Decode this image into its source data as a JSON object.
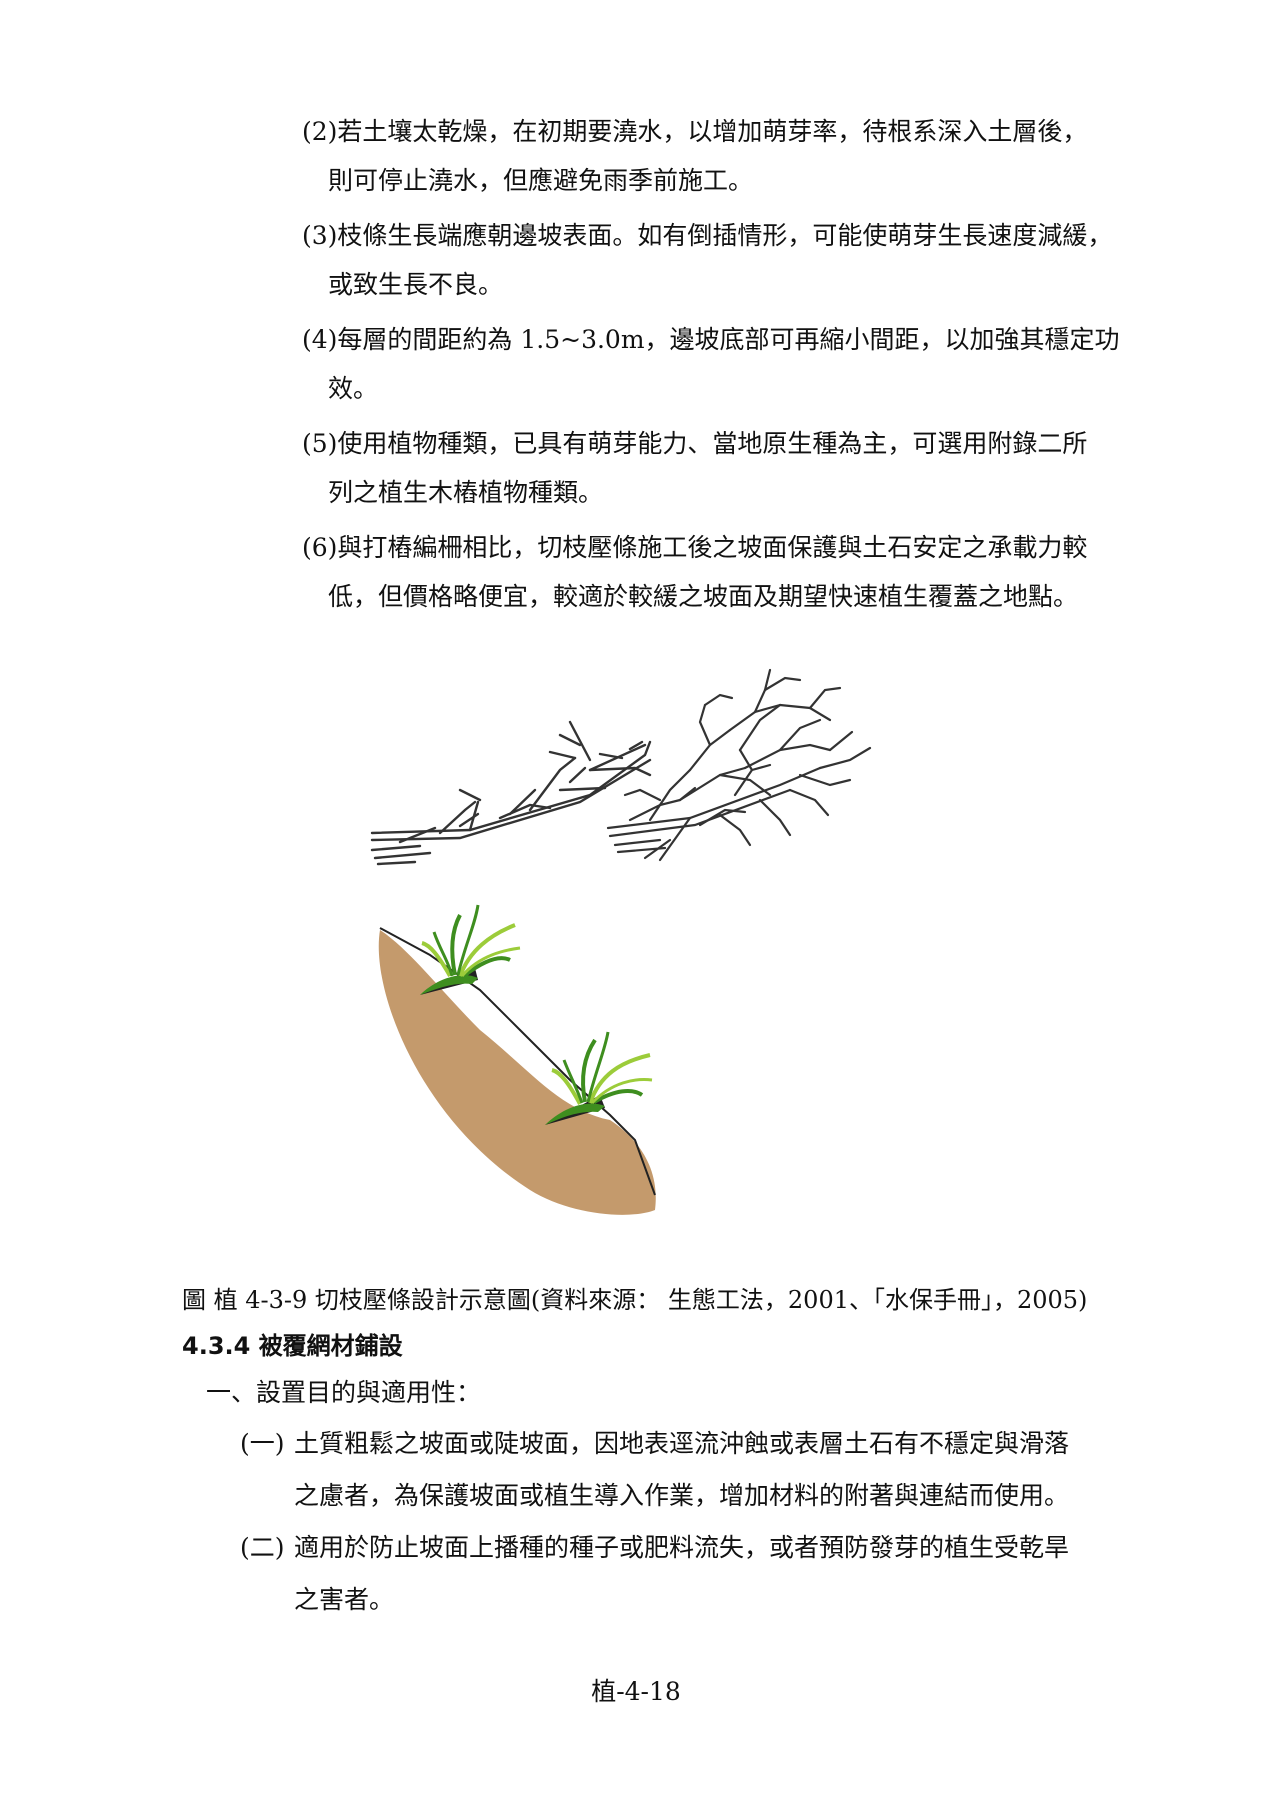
{
  "list_items": [
    {
      "line1": "(2)若土壤太乾燥，在初期要澆水，以增加萌芽率，待根系深入土層後，",
      "line2": "則可停止澆水，但應避免雨季前施工。"
    },
    {
      "line1": "(3)枝條生長端應朝邊坡表面。如有倒插情形，可能使萌芽生長速度減緩，",
      "line2": "或致生長不良。"
    },
    {
      "line1": "(4)每層的間距約為 1.5~3.0m，邊坡底部可再縮小間距，以加強其穩定功",
      "line2": "效。"
    },
    {
      "line1": "(5)使用植物種類，已具有萌芽能力、當地原生種為主，可選用附錄二所",
      "line2": "列之植生木樁植物種類。"
    },
    {
      "line1": "(6)與打樁編柵相比，切枝壓條施工後之坡面保護與土石安定之承載力較",
      "line2": "低，但價格略便宜，較適於較緩之坡面及期望快速植生覆蓋之地點。"
    }
  ],
  "figure": {
    "caption": "圖 植 4-3-9 切枝壓條設計示意圖(資料來源： 生態工法，2001、「水保手冊」，2005)",
    "colors": {
      "soil": "#c49a6c",
      "grass_dark": "#3e8e1f",
      "grass_light": "#9ccc3a",
      "branch": "#333333"
    }
  },
  "section": {
    "title": "4.3.4 被覆網材鋪設"
  },
  "subsection": {
    "title": "一、設置目的與適用性："
  },
  "paragraphs": [
    {
      "label": "(一)",
      "line1": "土質粗鬆之坡面或陡坡面，因地表逕流沖蝕或表層土石有不穩定與滑落",
      "line2": "之慮者，為保護坡面或植生導入作業，增加材料的附著與連結而使用。"
    },
    {
      "label": "(二)",
      "line1": "適用於防止坡面上播種的種子或肥料流失，或者預防發芽的植生受乾旱",
      "line2": "之害者。"
    }
  ],
  "footer": {
    "page_number": "植-4-18"
  }
}
